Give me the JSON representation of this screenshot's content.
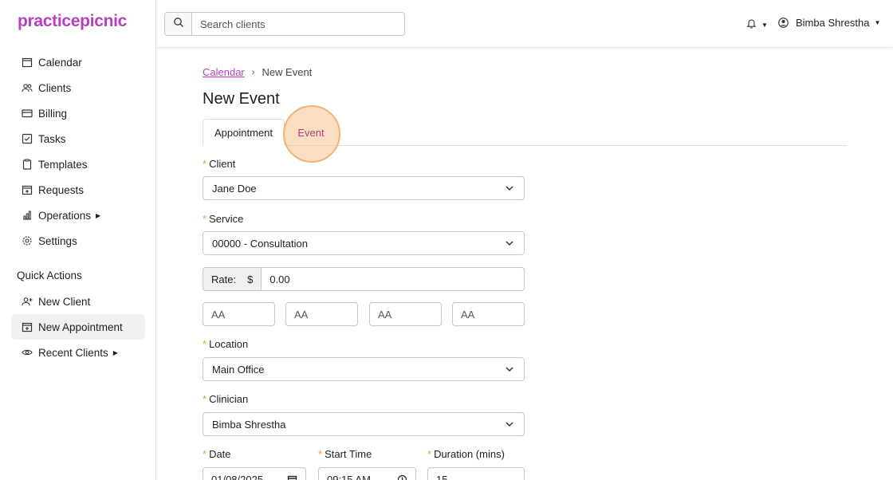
{
  "brand": {
    "logo": "practicepicnic",
    "color": "#b83fc1"
  },
  "sidebar": {
    "items": [
      {
        "label": "Calendar",
        "icon": "calendar-icon"
      },
      {
        "label": "Clients",
        "icon": "users-icon"
      },
      {
        "label": "Billing",
        "icon": "credit-card-icon"
      },
      {
        "label": "Tasks",
        "icon": "checkbox-icon"
      },
      {
        "label": "Templates",
        "icon": "clipboard-icon"
      },
      {
        "label": "Requests",
        "icon": "calendar-plus-icon"
      },
      {
        "label": "Operations",
        "icon": "bar-chart-icon"
      },
      {
        "label": "Settings",
        "icon": "gear-icon"
      }
    ],
    "quick_actions_title": "Quick Actions",
    "quick_actions": [
      {
        "label": "New Client",
        "icon": "user-plus-icon"
      },
      {
        "label": "New Appointment",
        "icon": "calendar-plus-icon"
      },
      {
        "label": "Recent Clients",
        "icon": "eye-icon"
      }
    ]
  },
  "topbar": {
    "search_placeholder": "Search clients",
    "user_name": "Bimba Shrestha"
  },
  "breadcrumb": {
    "parent": "Calendar",
    "current": "New Event"
  },
  "page_title": "New Event",
  "tabs": [
    {
      "label": "Appointment"
    },
    {
      "label": "Event"
    }
  ],
  "form": {
    "client": {
      "label": "Client",
      "value": "Jane Doe"
    },
    "service": {
      "label": "Service",
      "value": "00000 - Consultation"
    },
    "rate": {
      "label": "Rate:",
      "currency": "$",
      "value": "0.00"
    },
    "modifiers": [
      "AA",
      "AA",
      "AA",
      "AA"
    ],
    "location": {
      "label": "Location",
      "value": "Main Office"
    },
    "clinician": {
      "label": "Clinician",
      "value": "Bimba Shrestha"
    },
    "date": {
      "label": "Date",
      "value": "01/08/2025"
    },
    "start_time": {
      "label": "Start Time",
      "value": "09:15 AM"
    },
    "duration": {
      "label": "Duration (mins)",
      "value": "15"
    }
  },
  "colors": {
    "accent": "#b83fc1",
    "required": "#f0a030",
    "highlight": "#f3b27a"
  }
}
